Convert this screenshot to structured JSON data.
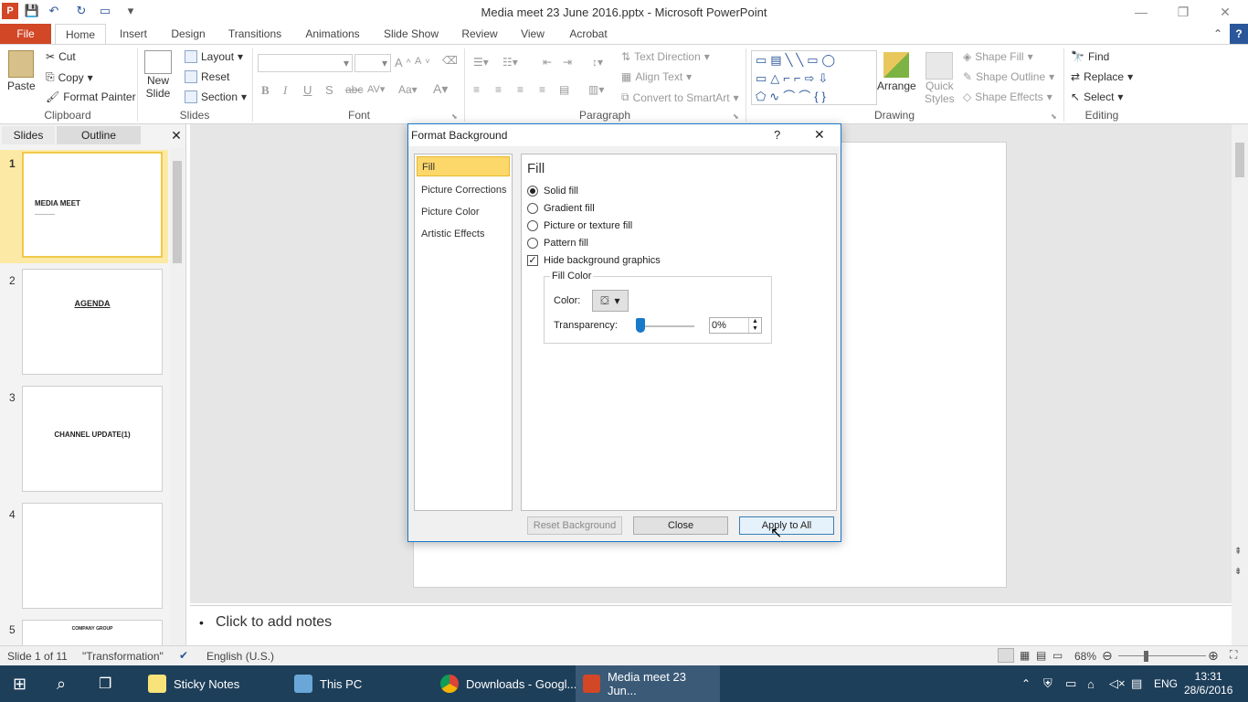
{
  "window": {
    "title": "Media meet  23 June 2016.pptx - Microsoft PowerPoint"
  },
  "tabs": [
    "File",
    "Home",
    "Insert",
    "Design",
    "Transitions",
    "Animations",
    "Slide Show",
    "Review",
    "View",
    "Acrobat"
  ],
  "ribbon": {
    "clipboard": {
      "label": "Clipboard",
      "paste": "Paste",
      "cut": "Cut",
      "copy": "Copy",
      "format_painter": "Format Painter"
    },
    "slides": {
      "label": "Slides",
      "new_slide_1": "New",
      "new_slide_2": "Slide",
      "layout": "Layout",
      "reset": "Reset",
      "section": "Section"
    },
    "font": {
      "label": "Font"
    },
    "paragraph": {
      "label": "Paragraph",
      "text_direction": "Text Direction",
      "align_text": "Align Text",
      "convert_smartart": "Convert to SmartArt"
    },
    "drawing": {
      "label": "Drawing",
      "arrange": "Arrange",
      "quick_styles_1": "Quick",
      "quick_styles_2": "Styles",
      "shape_fill": "Shape Fill",
      "shape_outline": "Shape Outline",
      "shape_effects": "Shape Effects"
    },
    "editing": {
      "label": "Editing",
      "find": "Find",
      "replace": "Replace",
      "select": "Select"
    }
  },
  "left_panel": {
    "tabs": [
      "Slides",
      "Outline"
    ],
    "thumbnails": [
      {
        "num": "1",
        "title": "MEDIA MEET"
      },
      {
        "num": "2",
        "title": "AGENDA"
      },
      {
        "num": "3",
        "title": "CHANNEL UPDATE(1)"
      },
      {
        "num": "4",
        "title": ""
      },
      {
        "num": "5",
        "title": "COMPANY GROUP"
      }
    ]
  },
  "notes": {
    "placeholder": "Click to add notes",
    "bullet": "•"
  },
  "dialog": {
    "title": "Format Background",
    "help": "?",
    "close_glyph": "✕",
    "categories": [
      "Fill",
      "Picture Corrections",
      "Picture Color",
      "Artistic Effects"
    ],
    "section_title": "Fill",
    "options": [
      "Solid fill",
      "Gradient fill",
      "Picture or texture fill",
      "Pattern fill"
    ],
    "selected_option": "Solid fill",
    "hide_bg": "Hide background graphics",
    "hide_bg_checked": true,
    "fill_color_legend": "Fill Color",
    "color_label": "Color:",
    "transparency_label": "Transparency:",
    "transparency_value": "0%",
    "buttons": {
      "reset": "Reset Background",
      "close": "Close",
      "apply_all": "Apply to All"
    }
  },
  "status": {
    "slide": "Slide 1 of 11",
    "theme": "\"Transformation\"",
    "language": "English (U.S.)",
    "zoom": "68%"
  },
  "taskbar": {
    "items": [
      "Sticky Notes",
      "This PC",
      "Downloads - Googl...",
      "Media meet  23 Jun..."
    ],
    "lang": "ENG",
    "time": "13:31",
    "date": "28/6/2016"
  }
}
